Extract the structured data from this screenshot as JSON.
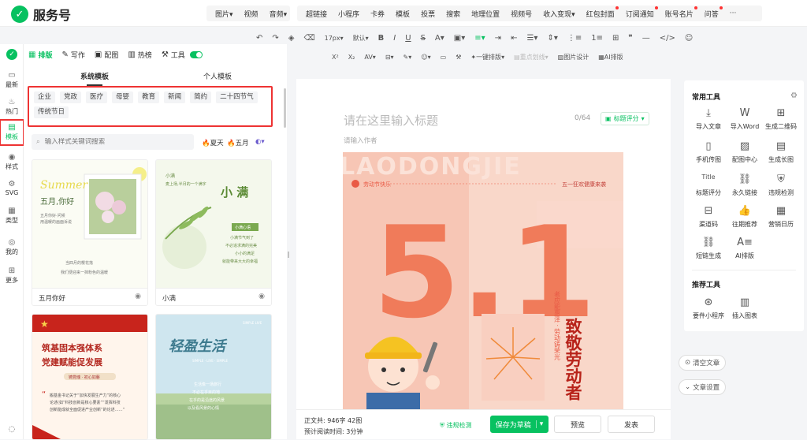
{
  "brand": {
    "name": "服务号"
  },
  "top_menu": {
    "group1": [
      "图片",
      "视频",
      "音频"
    ],
    "group2": [
      "超链接",
      "小程序",
      "卡券",
      "模板",
      "投票",
      "搜索",
      "地理位置",
      "视频号",
      "收入变现",
      "红包封面",
      "订阅通知",
      "账号名片",
      "问答",
      "···"
    ]
  },
  "toolbar": {
    "font_size": "17px",
    "font_default": "默认",
    "one_click_layout": "一键排版",
    "key_divider": "重点划线",
    "image_design": "图片设计",
    "ai_layout": "AI排版"
  },
  "left_nav": [
    {
      "label": "最新",
      "icon": "message-icon"
    },
    {
      "label": "热门",
      "icon": "fire-icon"
    },
    {
      "label": "模板",
      "icon": "template-icon"
    },
    {
      "label": "样式",
      "icon": "style-icon"
    },
    {
      "label": "SVG",
      "icon": "svg-icon"
    },
    {
      "label": "类型",
      "icon": "grid-icon"
    },
    {
      "label": "我的",
      "icon": "user-icon"
    },
    {
      "label": "更多",
      "icon": "more-icon"
    }
  ],
  "panel_tabs": [
    {
      "label": "排版",
      "icon": "layout-icon"
    },
    {
      "label": "写作",
      "icon": "pen-icon"
    },
    {
      "label": "配图",
      "icon": "image-icon"
    },
    {
      "label": "热榜",
      "icon": "rank-icon"
    },
    {
      "label": "工具",
      "icon": "tool-icon"
    }
  ],
  "sub_tabs": {
    "system": "系统模板",
    "personal": "个人模板"
  },
  "categories": [
    "企业",
    "党政",
    "医疗",
    "母婴",
    "教育",
    "新闻",
    "简约",
    "二十四节气",
    "传统节日"
  ],
  "search": {
    "placeholder": "输入样式关键词搜索"
  },
  "hot_tags": [
    "夏天",
    "五月"
  ],
  "templates": [
    {
      "name": "五月你好",
      "lines": [
        "Summer",
        "五月,你好",
        "五月你好·问候",
        "用温暖的画面诉说",
        "当四月的樱花落",
        "我们便迎来一抹粉色的温暖"
      ]
    },
    {
      "name": "小满",
      "lines": [
        "小满",
        "麦上场,半月的一个满字",
        "小 满",
        "小满心语",
        "小满节气到了",
        "不必追求满的完美",
        "小小的满足",
        "就能带来大大的幸福"
      ]
    },
    {
      "name": "",
      "lines": [
        "筑基固本强体系",
        "党建赋能促发展",
        "铸党魂 · 初心如磐",
        "“",
        "搬基金书记关于“加快发展生产力”的核心论述(如“科技创新是核心要素”“发挥科技创新能成就全面促进产业创新”的论述……”"
      ]
    },
    {
      "name": "",
      "lines": [
        "轻盈生活",
        "SIMPLE LIVE",
        "生活像一场旅行",
        "不必在乎目的地",
        "在乎的是沿途的风景",
        "以及看风景的心情"
      ]
    }
  ],
  "editor": {
    "title_placeholder": "请在这里输入标题",
    "title_count": "0/64",
    "title_score": "标题评分",
    "author_placeholder": "请输入作者",
    "poster": {
      "bg_text": "LAODONGJIE",
      "tag_left": "劳动节快乐",
      "tag_right": "五一狂欢健康来袭",
      "big": "5.1",
      "headline": "致敬劳动者",
      "side_text": "者应能惠泽 · 劳动铸荣光"
    }
  },
  "footer": {
    "text_count": "正文共: 946字 42图",
    "read_time": "预计阅读时间: 3分钟",
    "check": "违规检测",
    "save": "保存为草稿",
    "preview": "预览",
    "publish": "发表"
  },
  "right_panel": {
    "common_title": "常用工具",
    "common_tools": [
      {
        "label": "导入文章",
        "icon": "import-icon"
      },
      {
        "label": "导入Word",
        "icon": "word-icon"
      },
      {
        "label": "生成二维码",
        "icon": "qrcode-icon"
      },
      {
        "label": "手机传图",
        "icon": "phone-icon"
      },
      {
        "label": "配图中心",
        "icon": "picture-icon"
      },
      {
        "label": "生成长图",
        "icon": "longimage-icon"
      },
      {
        "label": "标题评分",
        "icon": "title-icon"
      },
      {
        "label": "永久链接",
        "icon": "link-icon"
      },
      {
        "label": "违规检测",
        "icon": "shield-icon"
      },
      {
        "label": "渠道码",
        "icon": "channel-icon"
      },
      {
        "label": "往期推荐",
        "icon": "thumb-icon"
      },
      {
        "label": "营销日历",
        "icon": "calendar-icon"
      },
      {
        "label": "短链生成",
        "icon": "shortlink-icon"
      },
      {
        "label": "AI排版",
        "icon": "ai-icon"
      }
    ],
    "recommend_title": "推荐工具",
    "recommend_tools": [
      {
        "label": "要件小程序",
        "icon": "miniapp-icon"
      },
      {
        "label": "插入图表",
        "icon": "chart-icon"
      }
    ]
  },
  "float_buttons": {
    "clear": "清空文章",
    "settings": "文章设置"
  }
}
